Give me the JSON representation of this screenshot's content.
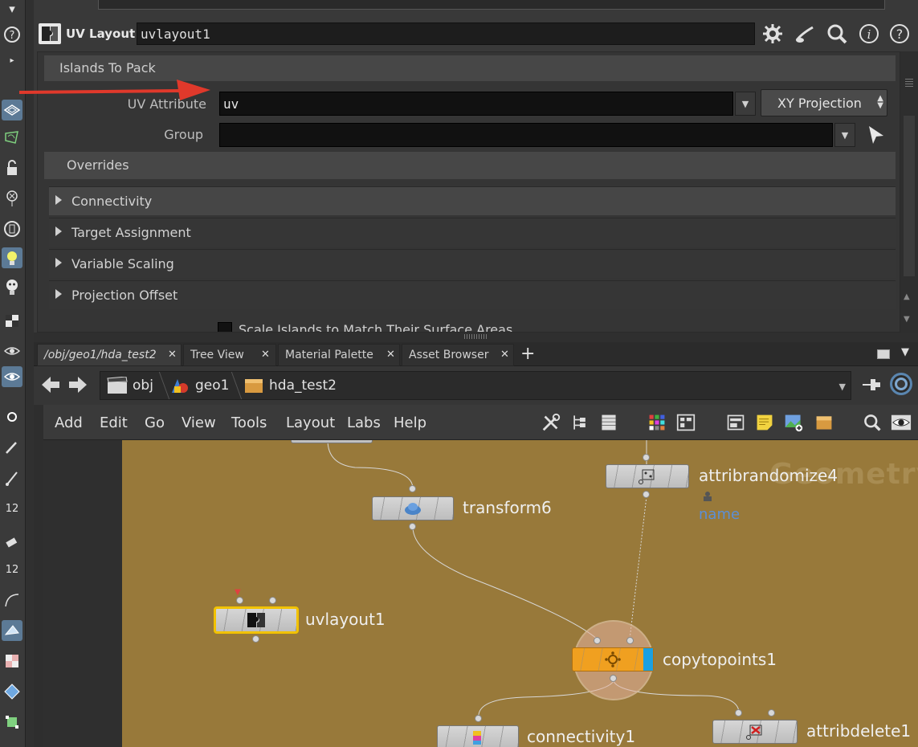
{
  "param_pane": {
    "node_type": "UV Layout",
    "node_name": "uvlayout1",
    "folder_islands": "Islands To Pack",
    "uv_attribute_label": "UV Attribute",
    "uv_attribute_value": "uv",
    "projection_button": "XY Projection",
    "group_label": "Group",
    "group_value": "",
    "folder_overrides": "Overrides",
    "subfolders": [
      "Connectivity",
      "Target Assignment",
      "Variable Scaling",
      "Projection Offset"
    ],
    "scale_islands_label": "Scale Islands to Match Their Surface Areas",
    "header_icons": [
      "gear-icon",
      "brush-icon",
      "search-icon",
      "info-icon",
      "help-icon"
    ]
  },
  "tabs": [
    {
      "label": "/obj/geo1/hda_test2",
      "active": true
    },
    {
      "label": "Tree View",
      "active": false
    },
    {
      "label": "Material Palette",
      "active": false
    },
    {
      "label": "Asset Browser",
      "active": false
    }
  ],
  "path": {
    "crumbs": [
      "obj",
      "geo1",
      "hda_test2"
    ]
  },
  "net_menu": [
    "Add",
    "Edit",
    "Go",
    "View",
    "Tools",
    "Layout",
    "Labs",
    "Help"
  ],
  "network": {
    "watermark": "Geometry",
    "nodes": {
      "transform": "transform6",
      "attribrandomize": "attribrandomize4",
      "attrib_sub": "name",
      "uvlayout": "uvlayout1",
      "copytopoints": "copytopoints1",
      "connectivity": "connectivity1",
      "attribdelete": "attribdelete1"
    }
  },
  "colors": {
    "canvas": "#98793a",
    "selected_outline": "#f2c200",
    "copy_node": "#f0a020",
    "sub_label": "#5b8fd6",
    "annotation_arrow": "#e0392b"
  }
}
